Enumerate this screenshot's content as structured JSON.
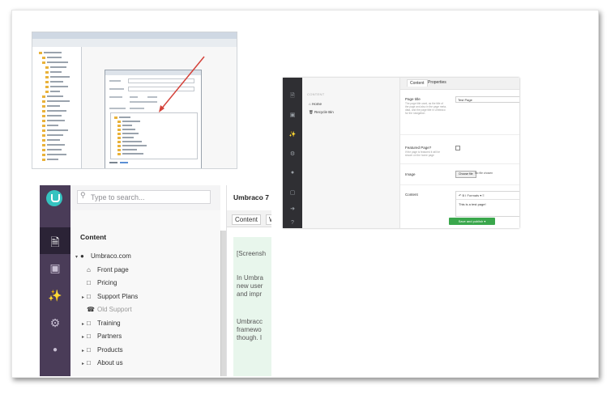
{
  "slide": {
    "legacy_screenshot": {
      "arrow_color": "#d4423a"
    },
    "backoffice": {
      "search_placeholder": "Type to search...",
      "section_title": "Content",
      "editor_title": "Umbraco 7",
      "tabs": [
        "Content",
        "W"
      ],
      "nav_icons": [
        "content-icon",
        "media-icon",
        "developer-icon",
        "settings-icon",
        "users-icon"
      ],
      "tree": [
        {
          "label": "Umbraco.com",
          "icon": "globe-icon",
          "caret": "▾",
          "dim": false
        },
        {
          "label": "Front page",
          "icon": "home-icon",
          "caret": "",
          "dim": false
        },
        {
          "label": "Pricing",
          "icon": "doc-icon",
          "caret": "",
          "dim": false
        },
        {
          "label": "Support Plans",
          "icon": "doc-icon",
          "caret": "▸",
          "dim": false
        },
        {
          "label": "Old Support",
          "icon": "support-icon",
          "caret": "",
          "dim": true
        },
        {
          "label": "Training",
          "icon": "doc-icon",
          "caret": "▸",
          "dim": false
        },
        {
          "label": "Partners",
          "icon": "doc-icon",
          "caret": "▸",
          "dim": false
        },
        {
          "label": "Products",
          "icon": "doc-icon",
          "caret": "▸",
          "dim": false
        },
        {
          "label": "About us",
          "icon": "doc-icon",
          "caret": "▸",
          "dim": false
        }
      ],
      "content_lines": [
        "[Screensh",
        "In Umbra",
        "new user",
        "and impr",
        "Umbracc",
        "framewo",
        "though. I"
      ]
    },
    "editor": {
      "tree_caption": "CONTENT",
      "tree_items": [
        "Home",
        "Recycle Bin"
      ],
      "tabs": [
        "Content",
        "Properties"
      ],
      "fields": [
        {
          "label": "Page title",
          "hint": "The page title used, as the title of the page and also in the page meta-data, and the page title in Umbraco for the navigation",
          "value": "Test Page"
        },
        {
          "label": "Featured Page?",
          "hint": "If the page is featured it will be shown on the home page"
        },
        {
          "label": "Image",
          "button": "Choose file",
          "no_file": "No file chosen"
        },
        {
          "label": "Content",
          "toolbar": "↶  B  I  Formats ▾  ≡",
          "body": "This is a test page!"
        }
      ],
      "save_button": "Save and publish ▾",
      "accent": "#3aa74c"
    }
  }
}
